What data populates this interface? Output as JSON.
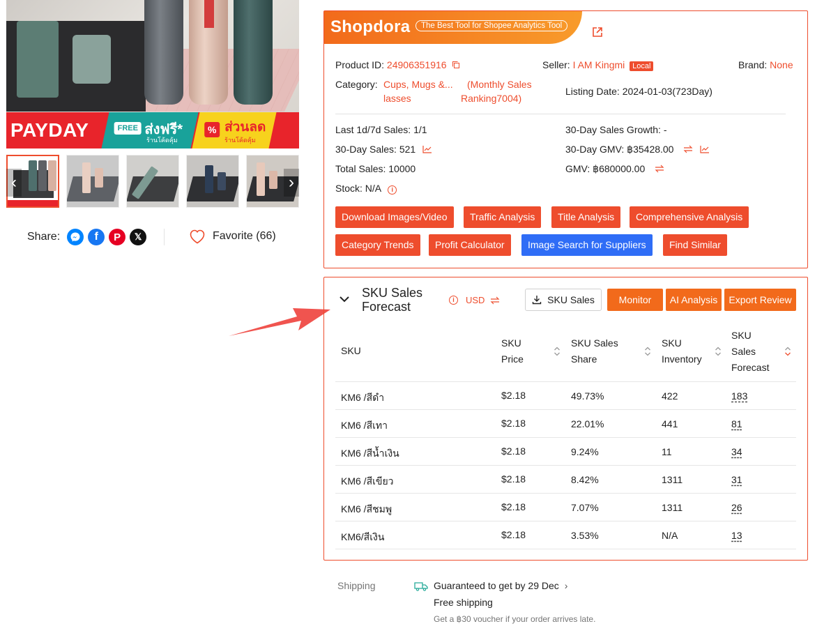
{
  "gallery": {
    "banner": {
      "payday": "PAYDAY",
      "free_badge": "FREE",
      "free_text": "ส่งฟรี*",
      "free_sub": "ร้านโค้ดคุ้ม",
      "discount_text": "ส่วนลด",
      "discount_sub": "ร้านโค้ดคุ้ม",
      "discount_symbol": "%"
    }
  },
  "share": {
    "label": "Share:",
    "icons": [
      "messenger-icon",
      "facebook-icon",
      "pinterest-icon",
      "x-icon"
    ]
  },
  "favorite": {
    "label": "Favorite (66)"
  },
  "shopdora": {
    "logo": "Shopdora",
    "tagline": "The Best Tool for Shopee Analytics Tool",
    "product_id_label": "Product ID:",
    "product_id": "24906351916",
    "seller_label": "Seller:",
    "seller": "I AM Kingmi",
    "seller_badge": "Local",
    "brand_label": "Brand:",
    "brand": "None",
    "category_label": "Category:",
    "category_line1": "Cups, Mugs &...",
    "category_line2": "lasses",
    "ranking_line1": "(Monthly Sales",
    "ranking_line2": "Ranking7004)",
    "listing_date_label": "Listing Date:",
    "listing_date": "2024-01-03(723Day)",
    "stats": {
      "last_sales": "Last 1d/7d Sales: 1/1",
      "sales_growth": "30-Day Sales Growth: -",
      "sales_30": "30-Day Sales: 521",
      "gmv_30_label": "30-Day GMV:",
      "gmv_30": "฿35428.00",
      "total_sales": "Total Sales: 10000",
      "gmv_label": "GMV:",
      "gmv": "฿680000.00",
      "stock": "Stock: N/A"
    },
    "buttons": [
      "Download Images/Video",
      "Traffic Analysis",
      "Title Analysis",
      "Comprehensive Analysis",
      "Category Trends",
      "Profit Calculator",
      "Image Search for Suppliers",
      "Find Similar"
    ]
  },
  "sku_forecast": {
    "title": "SKU Sales Forecast",
    "currency": "USD",
    "sku_sales_button": "SKU Sales",
    "monitor_button": "Monitor",
    "ai_button": "AI Analysis",
    "export_button": "Export Review",
    "headers": {
      "sku": "SKU",
      "price": "SKU Price",
      "share": "SKU Sales Share",
      "inventory": "SKU Inventory",
      "forecast": "SKU Sales Forecast"
    },
    "rows": [
      {
        "sku": "KM6 /สีดำ",
        "price": "$2.18",
        "share": "49.73%",
        "inventory": "422",
        "forecast": "183"
      },
      {
        "sku": "KM6 /สีเทา",
        "price": "$2.18",
        "share": "22.01%",
        "inventory": "441",
        "forecast": "81"
      },
      {
        "sku": "KM6 /สีน้ำเงิน",
        "price": "$2.18",
        "share": "9.24%",
        "inventory": "11",
        "forecast": "34"
      },
      {
        "sku": "KM6 /สีเขียว",
        "price": "$2.18",
        "share": "8.42%",
        "inventory": "1311",
        "forecast": "31"
      },
      {
        "sku": "KM6 /สีชมพู",
        "price": "$2.18",
        "share": "7.07%",
        "inventory": "1311",
        "forecast": "26"
      },
      {
        "sku": "KM6/สีเงิน",
        "price": "$2.18",
        "share": "3.53%",
        "inventory": "N/A",
        "forecast": "13"
      }
    ]
  },
  "shipping": {
    "label": "Shipping",
    "guarantee": "Guaranteed to get by 29 Dec",
    "free": "Free shipping",
    "voucher": "Get a ฿30 voucher if your order arrives late."
  },
  "colors": {
    "accent": "#ee4d2d",
    "blue_button": "#2f6df6",
    "header_gradient": [
      "#f26a1b",
      "#f89b2b"
    ]
  }
}
